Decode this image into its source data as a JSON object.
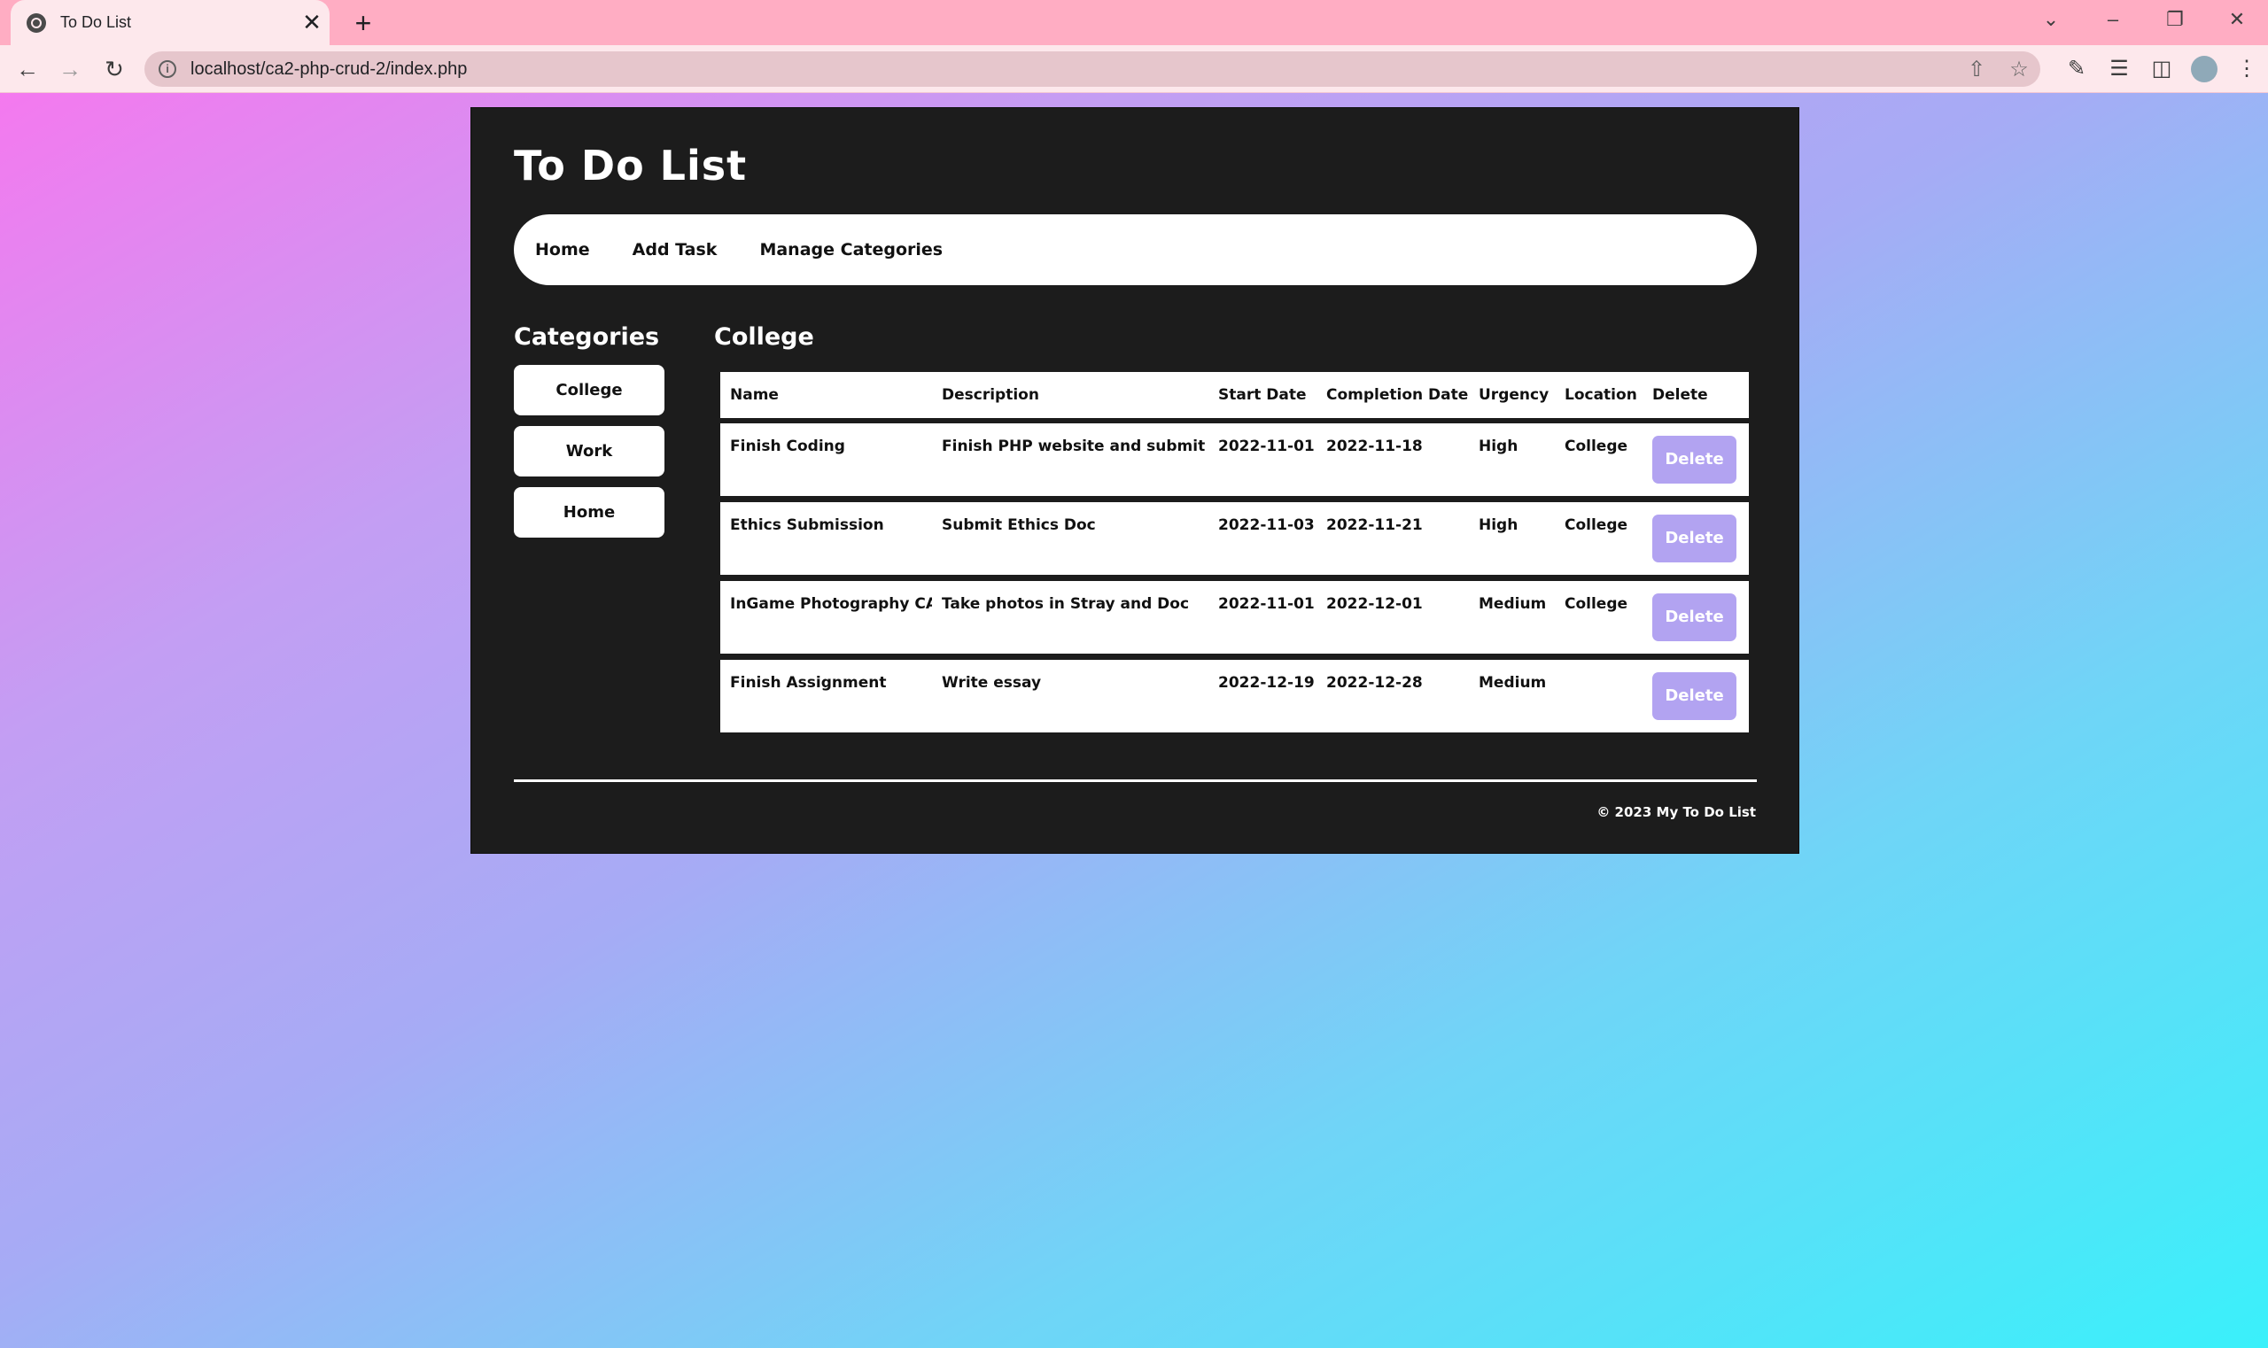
{
  "browser": {
    "tab_title": "To Do List",
    "tab_close": "✕",
    "new_tab": "+",
    "url": "localhost/ca2-php-crud-2/index.php",
    "window_controls": [
      "⌄",
      "–",
      "❐",
      "✕"
    ]
  },
  "header": {
    "title": "To Do List"
  },
  "nav": {
    "items": [
      "Home",
      "Add Task",
      "Manage Categories"
    ]
  },
  "sidebar": {
    "heading": "Categories",
    "categories": [
      "College",
      "Work",
      "Home"
    ]
  },
  "main": {
    "heading": "College",
    "columns": [
      "Name",
      "Description",
      "Start Date",
      "Completion Date",
      "Urgency",
      "Location",
      "Delete"
    ],
    "rows": [
      {
        "name": "Finish Coding",
        "description": "Finish PHP website and submit it",
        "start": "2022-11-01",
        "completion": "2022-11-18",
        "urgency": "High",
        "location": "College",
        "delete": "Delete"
      },
      {
        "name": "Ethics Submission",
        "description": "Submit Ethics Doc",
        "start": "2022-11-03",
        "completion": "2022-11-21",
        "urgency": "High",
        "location": "College",
        "delete": "Delete"
      },
      {
        "name": "InGame Photography CA",
        "description": "Take photos in Stray and Doc",
        "start": "2022-11-01",
        "completion": "2022-12-01",
        "urgency": "Medium",
        "location": "College",
        "delete": "Delete"
      },
      {
        "name": "Finish Assignment",
        "description": "Write essay",
        "start": "2022-12-19",
        "completion": "2022-12-28",
        "urgency": "Medium",
        "location": "",
        "delete": "Delete"
      }
    ]
  },
  "footer": {
    "text": "© 2023 My To Do List"
  },
  "colors": {
    "panel": "#1c1c1c",
    "delete_button": "#b2a3f1",
    "tabbar": "#ffadc3"
  }
}
